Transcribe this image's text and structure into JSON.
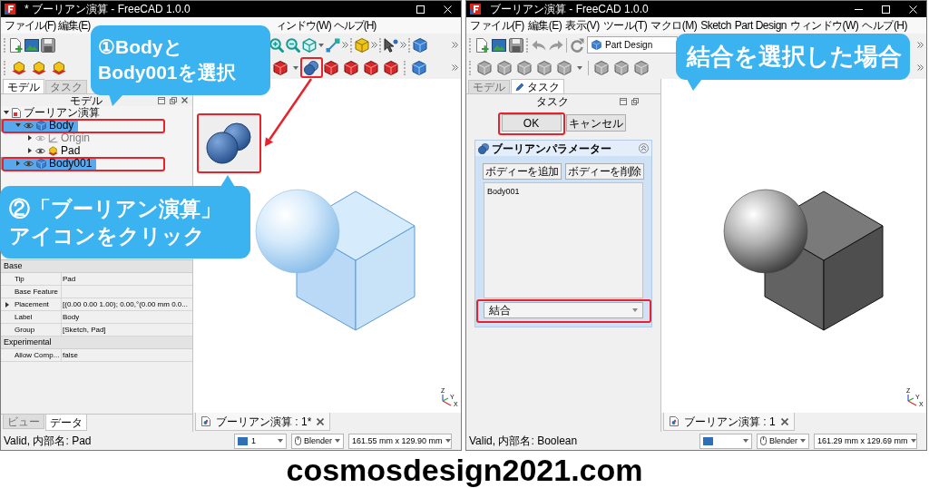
{
  "windows": [
    {
      "title": "* ブーリアン演算 - FreeCAD 1.0.0",
      "controls": [
        {
          "kind": "maximize"
        },
        {
          "kind": "close"
        }
      ],
      "menu": [
        "ファイル(F)",
        "編集(E)",
        "ィンドウ(W)",
        "ヘルプ(H)"
      ],
      "panel_tabs": [
        {
          "label": "モデル",
          "selected": true
        },
        {
          "label": "タスク",
          "selected": false
        }
      ],
      "panel": {
        "kind": "model",
        "title": "モデル",
        "tree": [
          {
            "label": "ブーリアン演算",
            "kind": "document",
            "expanded": true,
            "selected": false,
            "children": [
              {
                "label": "Body",
                "kind": "body",
                "expanded": true,
                "selected": true,
                "visible": true,
                "children": [
                  {
                    "label": "Origin",
                    "kind": "origin",
                    "expanded": false,
                    "selected": false,
                    "visible": false
                  },
                  {
                    "label": "Pad",
                    "kind": "pad",
                    "expanded": false,
                    "selected": false,
                    "visible": true
                  }
                ]
              },
              {
                "label": "Body001",
                "kind": "body",
                "expanded": false,
                "selected": true,
                "visible": true
              }
            ]
          }
        ],
        "properties": [
          {
            "group": "Base",
            "rows": [
              {
                "name": "Tip",
                "value": "Pad",
                "kind": "plain"
              },
              {
                "name": "Base Feature",
                "kind": "plain"
              },
              {
                "name": "Placement",
                "value": "[(0.00 0.00 1.00); 0.00,°(0.00 mm 0.0...",
                "kind": "expandable",
                "expanded": false
              },
              {
                "name": "Label",
                "value": "Body",
                "kind": "plain"
              },
              {
                "name": "Group",
                "value": "[Sketch, Pad]",
                "kind": "plain"
              }
            ]
          },
          {
            "group": "Experimental",
            "rows": [
              {
                "name": "Allow Comp...",
                "value": "false",
                "kind": "plain"
              }
            ]
          }
        ]
      },
      "bottom_tabs": [
        {
          "label": "ビュー",
          "selected": false
        },
        {
          "label": "データ",
          "selected": true
        }
      ],
      "view": {
        "selected": true,
        "axis_labels": [
          "Z",
          "Y",
          "X"
        ]
      },
      "document_tab": "ブーリアン演算 : 1*",
      "status_bar": {
        "message": "Valid, 内部名: Pad",
        "draw_style": "1",
        "navigation": "Blender",
        "dimensions": "161.55 mm x 129.90 mm"
      }
    },
    {
      "title": "ブーリアン演算 - FreeCAD 1.0.0",
      "controls": [
        {
          "kind": "minimize"
        },
        {
          "kind": "maximize"
        },
        {
          "kind": "close"
        }
      ],
      "menu": [
        "ファイル(F)",
        "編集(E)",
        "表示(V)",
        "ツール(T)",
        "マクロ(M)",
        "Sketch",
        "Part Design",
        "ウィンドウ(W)",
        "ヘルプ(H)"
      ],
      "workbench": "Part Design",
      "panel_tabs": [
        {
          "label": "モデル",
          "selected": false
        },
        {
          "label": "タスク",
          "selected": true
        }
      ],
      "panel": {
        "kind": "task",
        "title": "タスク",
        "buttons": [
          "OK",
          "キャンセル"
        ],
        "box": {
          "title": "ブーリアンパラメーター",
          "expanded": true,
          "buttons": [
            "ボディーを追加",
            "ボディーを削除"
          ],
          "bodies": [
            "Body001"
          ],
          "operation": "結合"
        }
      },
      "view": {
        "selected": false,
        "axis_labels": [
          "Z",
          "Y",
          "X"
        ]
      },
      "document_tab": "ブーリアン演算 : 1",
      "status_bar": {
        "message": "Valid, 内部名: Boolean",
        "navigation": "Blender",
        "dimensions": "161.29 mm x 129.69 mm"
      }
    }
  ],
  "callouts": [
    {
      "lines": [
        "①Bodyと",
        "Body001を選択"
      ]
    },
    {
      "lines": [
        "②「ブーリアン演算」",
        "アイコンをクリック"
      ]
    },
    {
      "lines": [
        "結合を選択した場合"
      ]
    }
  ],
  "caption": "cosmosdesign2021.com"
}
